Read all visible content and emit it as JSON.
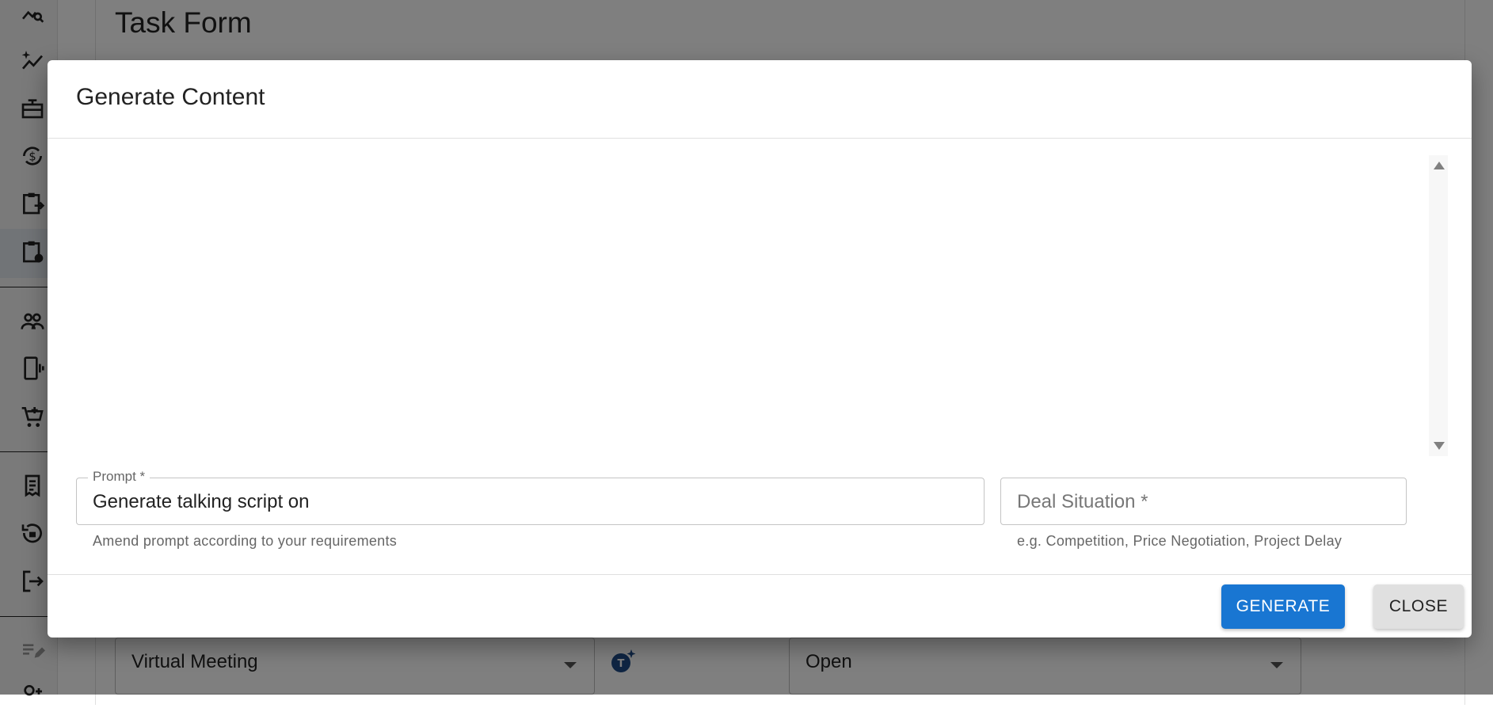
{
  "page": {
    "title": "Task Form"
  },
  "sidebar": {
    "icons": [
      "analytics-search-icon",
      "sparkle-chart-icon",
      "gift-box-icon",
      "currency-exchange-icon",
      "clipboard-transfer-icon",
      "clipboard-clock-icon",
      "people-group-icon",
      "mobile-vibrate-icon",
      "add-cart-icon",
      "receipt-icon",
      "lock-history-icon",
      "logout-icon",
      "edit-note-icon",
      "person-add-icon"
    ],
    "active_index": 5
  },
  "background_form": {
    "meeting_type_value": "Virtual Meeting",
    "status_value": "Open"
  },
  "dialog": {
    "title": "Generate Content",
    "prompt": {
      "label": "Prompt *",
      "value": "Generate talking script on",
      "helper": "Amend prompt according to your requirements"
    },
    "deal_situation": {
      "placeholder": "Deal Situation *",
      "helper": "e.g. Competition, Price Negotiation, Project Delay"
    },
    "buttons": {
      "generate": "GENERATE",
      "close": "CLOSE"
    }
  },
  "colors": {
    "primary": "#1976d2",
    "backdrop": "rgba(0,0,0,0.5)"
  }
}
